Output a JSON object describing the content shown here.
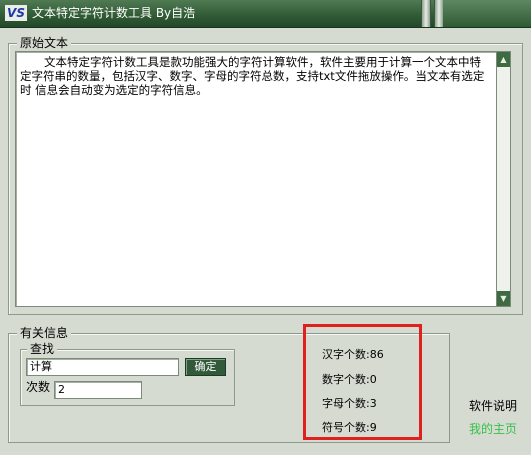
{
  "window": {
    "logo_text": "VS",
    "title": "文本特定字符计数工具 By自浩"
  },
  "source_group": {
    "label": "原始文本",
    "text": "文本特定字符计数工具是款功能强大的字符计算软件，软件主要用于计算一个文本中特定字符串的数量，包括汉字、数字、字母的字符总数，支持txt文件拖放操作。当文本有选定时 信息会自动变为选定的字符信息。"
  },
  "info_group": {
    "label": "有关信息",
    "search_label": "查找",
    "search_value": "计算",
    "calc_button": "确定",
    "count_label": "次数",
    "count_value": "2"
  },
  "stats": {
    "hanzi": "汉字个数:86",
    "digits": "数字个数:0",
    "letters": "字母个数:3",
    "symbols": "符号个数:9"
  },
  "links": {
    "help": "软件说明",
    "home": "我的主页"
  },
  "colors": {
    "titlebar": "#2f5a34",
    "highlight": "#e0201f",
    "home_link": "#37c04a"
  }
}
